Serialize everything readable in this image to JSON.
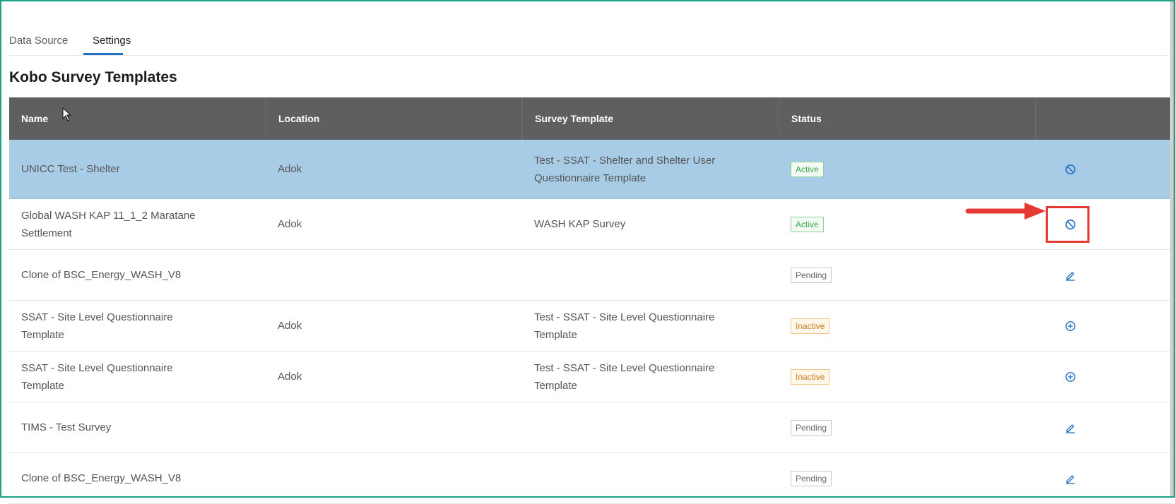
{
  "tabs": [
    {
      "label": "Data Source"
    },
    {
      "label": "Settings",
      "selected": true
    }
  ],
  "page_title": "Kobo Survey Templates",
  "table": {
    "headers": [
      "Name",
      "Location",
      "Survey Template",
      "Status",
      ""
    ],
    "rows": [
      {
        "name": "UNICC Test - Shelter",
        "location": "Adok",
        "template": "Test - SSAT - Shelter and Shelter User Questionnaire Template",
        "status": "Active",
        "action_icon": "disable-icon",
        "selected": true
      },
      {
        "name": "Global WASH KAP 11_1_2 Maratane Settlement",
        "location": "Adok",
        "template": "WASH KAP Survey",
        "status": "Active",
        "action_icon": "disable-icon"
      },
      {
        "name": "Clone of BSC_Energy_WASH_V8",
        "location": "",
        "template": "",
        "status": "Pending",
        "action_icon": "edit-icon"
      },
      {
        "name": "SSAT - Site Level Questionnaire Template",
        "location": "Adok",
        "template": "Test - SSAT - Site Level Questionnaire Template",
        "status": "Inactive",
        "action_icon": "add-circle-icon"
      },
      {
        "name": "SSAT - Site Level Questionnaire Template",
        "location": "Adok",
        "template": "Test - SSAT - Site Level Questionnaire Template",
        "status": "Inactive",
        "action_icon": "add-circle-icon"
      },
      {
        "name": "TIMS - Test Survey",
        "location": "",
        "template": "",
        "status": "Pending",
        "action_icon": "edit-icon"
      },
      {
        "name": "Clone of BSC_Energy_WASH_V8",
        "location": "",
        "template": "",
        "status": "Pending",
        "action_icon": "edit-icon"
      }
    ]
  },
  "colors": {
    "header_bg": "#5f5f5f",
    "selected_row_bg": "#a8cbe6",
    "accent": "#1f6fc6",
    "annotation": "#e53935",
    "frame": "#1aa586"
  }
}
